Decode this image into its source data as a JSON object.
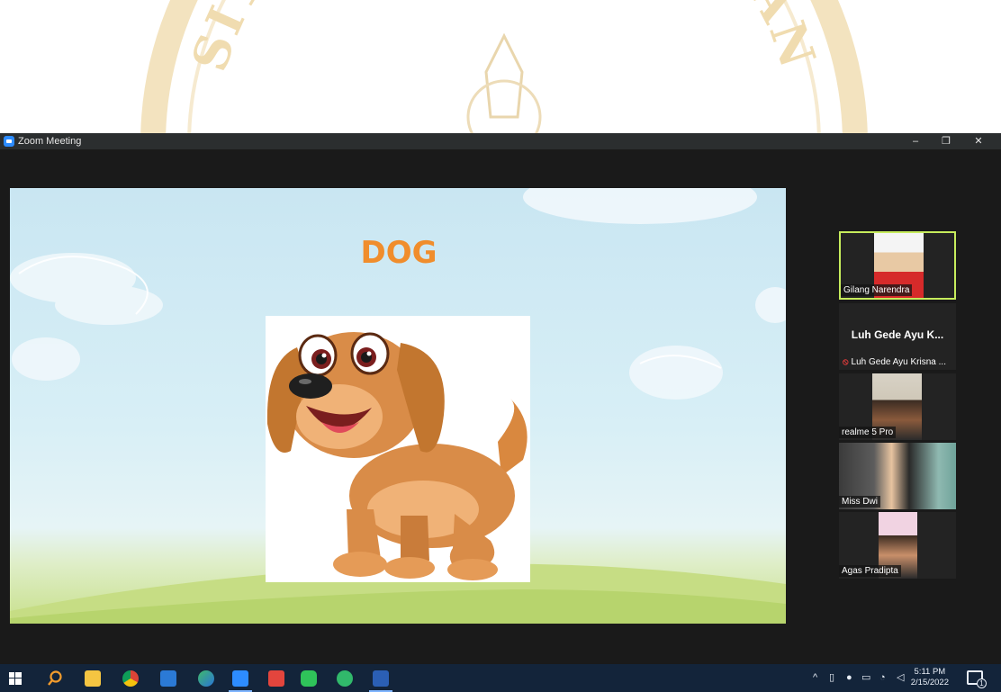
{
  "watermark": {
    "text": "SITAS PENDIDIKAN GAN"
  },
  "window": {
    "title": "Zoom Meeting",
    "controls": {
      "minimize": "–",
      "restore": "❐",
      "close": "✕"
    }
  },
  "slide": {
    "title": "DOG"
  },
  "participants": [
    {
      "name": "Gilang Narendra",
      "video": true,
      "active": true
    },
    {
      "display_name": "Luh Gede Ayu K...",
      "name": "Luh Gede Ayu Krisna ...",
      "video": false,
      "muted": true
    },
    {
      "name": "realme 5 Pro",
      "video": true
    },
    {
      "name": "Miss Dwi",
      "video": true
    },
    {
      "name": "Agas Pradipta",
      "video": true
    }
  ],
  "taskbar": {
    "apps": [
      "start-icon",
      "search-icon",
      "file-explorer-icon",
      "chrome-icon",
      "store-icon",
      "browser-icon",
      "zoom-icon",
      "media-icon",
      "line-icon",
      "whatsapp-icon",
      "word-icon"
    ],
    "tray": {
      "chevron": "^",
      "icons": [
        "network-icon",
        "mic-icon",
        "battery-icon",
        "wifi-icon",
        "volume-icon"
      ]
    },
    "clock": {
      "time": "5:11 PM",
      "date": "2/15/2022"
    },
    "notification_badge": "1"
  },
  "colors": {
    "accent": "#f08d2c",
    "active_speaker": "#c6ec5c",
    "zoom_blue": "#2d8cff",
    "taskbar": "#13243a"
  }
}
